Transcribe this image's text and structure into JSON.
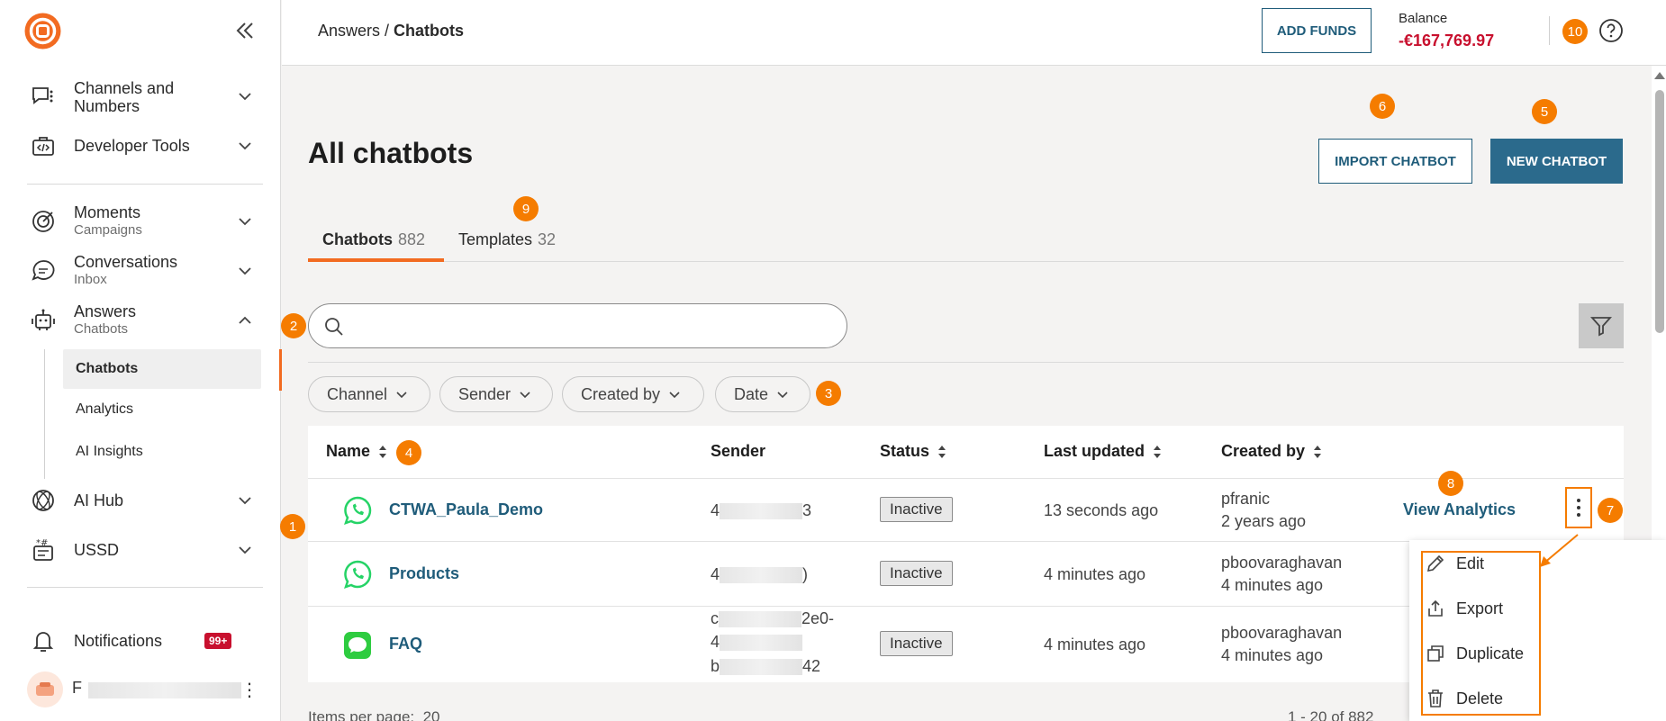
{
  "sidebar": {
    "items": [
      {
        "title": "Channels and Numbers",
        "sub": ""
      },
      {
        "title": "Developer Tools",
        "sub": ""
      },
      {
        "title": "Moments",
        "sub": "Campaigns"
      },
      {
        "title": "Conversations",
        "sub": "Inbox"
      },
      {
        "title": "Answers",
        "sub": "Chatbots"
      },
      {
        "title": "AI Hub",
        "sub": ""
      },
      {
        "title": "USSD",
        "sub": ""
      }
    ],
    "subnav": [
      "Chatbots",
      "Analytics",
      "AI Insights"
    ],
    "notifications": "Notifications",
    "notifications_badge": "99+",
    "user_initial": "F"
  },
  "header": {
    "breadcrumb_parent": "Answers",
    "breadcrumb_sep": " / ",
    "breadcrumb_current": "Chatbots",
    "add_funds": "ADD FUNDS",
    "balance_label": "Balance",
    "balance_value": "-€167,769.97"
  },
  "main": {
    "title": "All chatbots",
    "import_button": "IMPORT CHATBOT",
    "new_button": "NEW CHATBOT",
    "tabs": [
      {
        "label": "Chatbots",
        "count": "882"
      },
      {
        "label": "Templates",
        "count": "32"
      }
    ],
    "search_placeholder": "",
    "filters": [
      "Channel",
      "Sender",
      "Created by",
      "Date"
    ]
  },
  "table": {
    "columns": [
      "Name",
      "Sender",
      "Status",
      "Last updated",
      "Created by"
    ],
    "rows": [
      {
        "name": "CTWA_Paula_Demo",
        "sender_start": "4",
        "sender_end": "3",
        "status": "Inactive",
        "updated": "13 seconds ago",
        "creator": "pfranic",
        "created": "2 years ago",
        "channel": "whatsapp"
      },
      {
        "name": "Products",
        "sender_start": "4",
        "sender_end": ")",
        "status": "Inactive",
        "updated": "4 minutes ago",
        "creator": "pboovaraghavan",
        "created": "4 minutes ago",
        "channel": "whatsapp"
      },
      {
        "name": "FAQ",
        "sender_line1": "c",
        "sender_line1_end": "2e0-",
        "sender_line2": "4",
        "sender_line3": "b",
        "sender_line3_end": "42",
        "status": "Inactive",
        "updated": "4 minutes ago",
        "creator": "pboovaraghavan",
        "created": "4 minutes ago",
        "channel": "message"
      }
    ],
    "view_analytics": "View Analytics"
  },
  "menu": {
    "items": [
      "Edit",
      "Export",
      "Duplicate",
      "Delete"
    ]
  },
  "footer": {
    "items_per_page_label": "Items per page:",
    "items_per_page_value": "20",
    "range": "1 - 20 of 882"
  },
  "markers": [
    "1",
    "2",
    "3",
    "4",
    "5",
    "6",
    "7",
    "8",
    "9",
    "10"
  ],
  "colors": {
    "accent": "#f26b21",
    "marker": "#f57c00",
    "primary": "#2b6a8c",
    "danger": "#c8102e"
  }
}
